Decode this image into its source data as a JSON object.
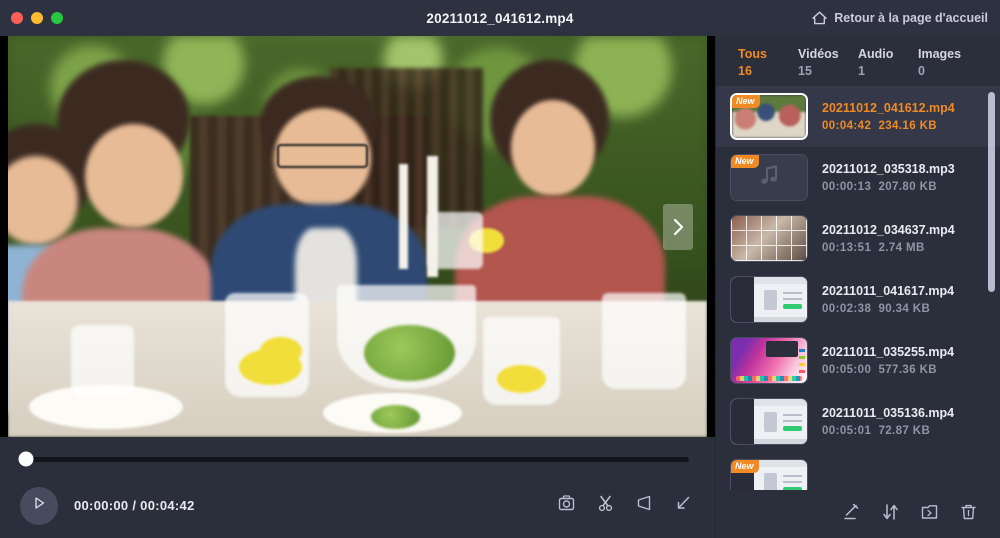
{
  "window": {
    "title": "20211012_041612.mp4",
    "home_button_label": "Retour à la page d'accueil",
    "home_icon": "house-icon",
    "traffic_lights": [
      "close-red",
      "minimize-yellow",
      "maximize-green"
    ]
  },
  "player": {
    "next_icon": "chevron-right-icon",
    "play_icon": "play-icon",
    "time_display": "00:00:00 / 00:04:42",
    "current_time": "00:00:00",
    "total_time": "00:04:42",
    "progress_percent": 0,
    "controls": [
      {
        "name": "snapshot-icon",
        "glyph": "camera"
      },
      {
        "name": "cut-icon",
        "glyph": "scissors"
      },
      {
        "name": "volume-icon",
        "glyph": "speaker"
      },
      {
        "name": "fullscreen-icon",
        "glyph": "expand"
      }
    ]
  },
  "sidebar": {
    "tabs": [
      {
        "label": "Tous",
        "count": "16",
        "active": true
      },
      {
        "label": "Vidéos",
        "count": "15",
        "active": false
      },
      {
        "label": "Audio",
        "count": "1",
        "active": false
      },
      {
        "label": "Images",
        "count": "0",
        "active": false
      }
    ],
    "badge_text": "New",
    "items": [
      {
        "name": "20211012_041612.mp4",
        "duration": "00:04:42",
        "size": "234.16 KB",
        "badge": true,
        "selected": true,
        "thumb": "photo"
      },
      {
        "name": "20211012_035318.mp3",
        "duration": "00:00:13",
        "size": "207.80 KB",
        "badge": true,
        "selected": false,
        "thumb": "audio"
      },
      {
        "name": "20211012_034637.mp4",
        "duration": "00:13:51",
        "size": "2.74 MB",
        "badge": false,
        "selected": false,
        "thumb": "film"
      },
      {
        "name": "20211011_041617.mp4",
        "duration": "00:02:38",
        "size": "90.34 KB",
        "badge": false,
        "selected": false,
        "thumb": "app"
      },
      {
        "name": "20211011_035255.mp4",
        "duration": "00:05:00",
        "size": "577.36 KB",
        "badge": false,
        "selected": false,
        "thumb": "desktop"
      },
      {
        "name": "20211011_035136.mp4",
        "duration": "00:05:01",
        "size": "72.87 KB",
        "badge": false,
        "selected": false,
        "thumb": "app"
      },
      {
        "name": "",
        "duration": "",
        "size": "",
        "badge": true,
        "selected": false,
        "thumb": "app"
      }
    ],
    "actions": [
      {
        "name": "edit-icon",
        "glyph": "pencil"
      },
      {
        "name": "sort-icon",
        "glyph": "sort-arrows"
      },
      {
        "name": "open-folder-icon",
        "glyph": "folder-arrow"
      },
      {
        "name": "delete-icon",
        "glyph": "trash"
      }
    ]
  },
  "colors": {
    "accent": "#f08a24",
    "window_bg": "#2b2e3b",
    "titlebar_bg": "#2e3140",
    "row_selected_bg": "#343849",
    "text_primary": "#e9ebf3",
    "text_secondary": "#8f94a6"
  }
}
